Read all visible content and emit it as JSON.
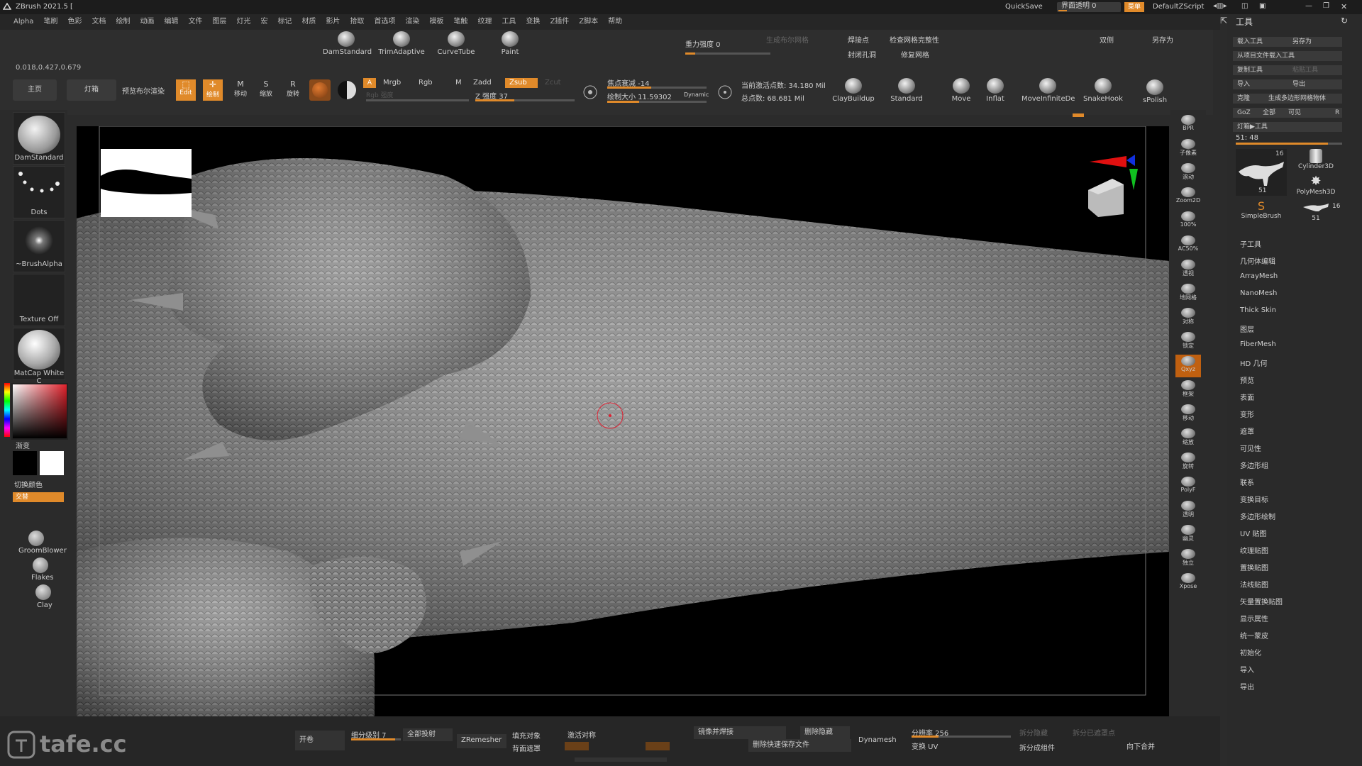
{
  "app": {
    "title": "ZBrush 2021.5 [",
    "quicksave": "QuickSave",
    "ui_transparency": "界面透明 0",
    "menu_label": "菜单",
    "script": "DefaultZScript"
  },
  "menubar": [
    "Alpha",
    "笔刷",
    "色彩",
    "文档",
    "绘制",
    "动画",
    "编辑",
    "文件",
    "图层",
    "灯光",
    "宏",
    "标记",
    "材质",
    "影片",
    "拾取",
    "首选项",
    "渲染",
    "模板",
    "笔触",
    "纹理",
    "工具",
    "变换",
    "Z插件",
    "Z脚本",
    "帮助"
  ],
  "shelf": {
    "coords": "0.018,0.427,0.679",
    "home": "主页",
    "light_box": "灯箱",
    "preview_render": "预览布尔渲染",
    "brushes": [
      "DamStandard",
      "TrimAdaptive",
      "CurveTube",
      "Paint"
    ],
    "gravity": "重力强度 0",
    "gen_normal": "生成布尔网格",
    "weld": "焊接点",
    "check_mesh": "检查网格完整性",
    "close_holes": "封闭孔洞",
    "repair_mesh": "修复网格",
    "double": "双侧",
    "save_as_top": "另存为",
    "modes": [
      "Edit",
      "绘制",
      "移动",
      "缩放",
      "旋转"
    ],
    "a_label": "A",
    "mrgb": "Mrgb",
    "rgb": "Rgb",
    "m": "M",
    "zadd": "Zadd",
    "zsub": "Zsub",
    "zcut": "Zcut",
    "rgb_intensity": "Rgb 强度",
    "z_intensity": "Z 强度 37",
    "focal": "焦点衰减 -14",
    "draw_size": "绘制大小 11.59302",
    "dynamic": "Dynamic",
    "active_points": "当前激活点数: 34.180 Mil",
    "total_points": "总点数: 68.681 Mil",
    "brushes2": [
      "ClayBuildup",
      "Standard",
      "Move",
      "Inflat",
      "MoveInfiniteDe",
      "SnakeHook",
      "sPolish"
    ]
  },
  "left": {
    "tiles": [
      "DamStandard",
      "Dots",
      "~BrushAlpha",
      "Texture Off",
      "MatCap White C"
    ],
    "gradient": "渐变",
    "switch_color": "切换颜色",
    "alternate": "交替",
    "bottom": [
      "GroomBlower",
      "Flakes",
      "Clay"
    ]
  },
  "rightstrip": [
    "BPR",
    "子像素",
    "滚动",
    "Zoom2D",
    "100%",
    "AC50%",
    "透视",
    "地网格",
    "对称",
    "锁定",
    "Qxyz",
    "框架",
    "移动",
    "缩放",
    "旋转",
    "PolyF",
    "透明",
    "幽灵",
    "独立",
    "Xpose"
  ],
  "toolpanel": {
    "title": "工具",
    "buttons": [
      [
        "载入工具",
        "另存为"
      ],
      [
        "从项目文件载入工具",
        ""
      ],
      [
        "复制工具",
        "粘贴工具"
      ],
      [
        "导入",
        "导出"
      ],
      [
        "克隆",
        "生成多边形网格物体"
      ],
      [
        "GoZ",
        "全部",
        "可见",
        "R"
      ]
    ],
    "light_tool": "灯箱▶工具",
    "count": "51: 48",
    "tools": [
      {
        "name": "",
        "num": "16",
        "sub": "51"
      },
      {
        "name": "Cylinder3D",
        "num": ""
      },
      {
        "name": "PolyMesh3D",
        "num": ""
      },
      {
        "name": "SimpleBrush",
        "num": ""
      },
      {
        "name": "",
        "num": "16",
        "sub": "51"
      }
    ],
    "items": [
      "子工具",
      "几何体编辑",
      "ArrayMesh",
      "NanoMesh",
      "Thick Skin",
      "图层",
      "FiberMesh",
      "HD 几何",
      "预览",
      "表面",
      "变形",
      "遮罩",
      "可见性",
      "多边形组",
      "联系",
      "变换目标",
      "多边形绘制",
      "UV 贴图",
      "纹理贴图",
      "置换贴图",
      "法线贴图",
      "矢量置换贴图",
      "显示属性",
      "统一蒙皮",
      "初始化",
      "导入",
      "导出"
    ]
  },
  "bottom": {
    "open": "开卷",
    "subdiv": "细分级别 7",
    "all_proj": "全部投射",
    "zremesher": "ZRemesher",
    "fill_obj": "填充对象",
    "activate_sym": "激活对称",
    "back_mask": "背面遮罩",
    "mirror_weld": "镜像并焊接",
    "del_hidden": "删除隐藏",
    "del_quick": "删除快速保存文件",
    "dynamesh": "Dynamesh",
    "resolution": "分辨率 256",
    "switch_uv": "变换 UV",
    "split_hidden": "拆分隐藏",
    "split_masked": "拆分已遮罩点",
    "split_parts": "拆分成组件",
    "merge_down": "向下合并"
  },
  "watermark": "tafe.cc"
}
